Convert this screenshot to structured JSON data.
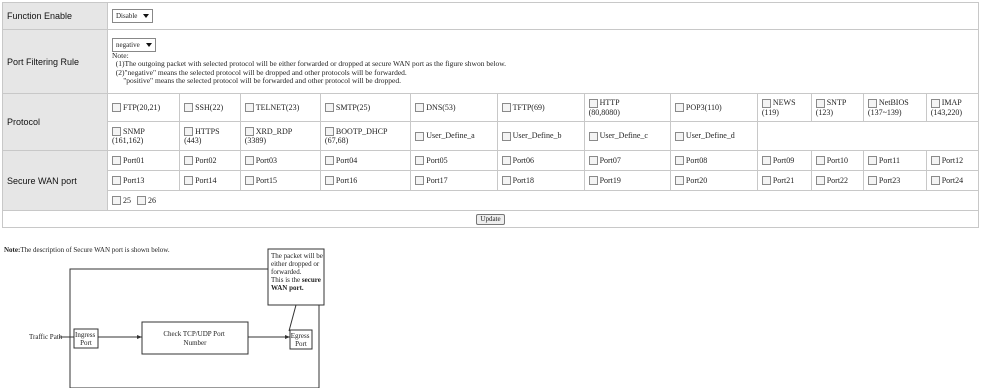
{
  "function_enable": {
    "label": "Function Enable",
    "value": "Disable"
  },
  "port_filtering": {
    "label": "Port Filtering Rule",
    "value": "negative",
    "note_title": "Note:",
    "note_lines": [
      "(1)The outgoing packet with selected protocol will be either forwarded or dropped at secure WAN port as the figure shwon below.",
      "(2)\"negative\" means the selected protocol will be dropped and other protocols will be forwarded.",
      "\"positive\" means the selected protocol will be forwarded and other protocol will be dropped."
    ]
  },
  "protocol": {
    "label": "Protocol",
    "row1": [
      {
        "l1": "FTP(20,21)",
        "l2": ""
      },
      {
        "l1": "SSH(22)",
        "l2": ""
      },
      {
        "l1": "TELNET(23)",
        "l2": ""
      },
      {
        "l1": "SMTP(25)",
        "l2": ""
      },
      {
        "l1": "DNS(53)",
        "l2": ""
      },
      {
        "l1": "TFTP(69)",
        "l2": ""
      },
      {
        "l1": "HTTP",
        "l2": "(80,8080)"
      },
      {
        "l1": "POP3(110)",
        "l2": ""
      },
      {
        "l1": "NEWS",
        "l2": "(119)"
      },
      {
        "l1": "SNTP",
        "l2": "(123)"
      },
      {
        "l1": "NetBIOS",
        "l2": "(137~139)"
      },
      {
        "l1": "IMAP",
        "l2": "(143,220)"
      }
    ],
    "row2": [
      {
        "l1": "SNMP",
        "l2": "(161,162)"
      },
      {
        "l1": "HTTPS",
        "l2": "(443)"
      },
      {
        "l1": "XRD_RDP",
        "l2": "(3389)"
      },
      {
        "l1": "BOOTP_DHCP",
        "l2": "(67,68)"
      },
      {
        "l1": "User_Define_a",
        "l2": ""
      },
      {
        "l1": "User_Define_b",
        "l2": ""
      },
      {
        "l1": "User_Define_c",
        "l2": ""
      },
      {
        "l1": "User_Define_d",
        "l2": ""
      }
    ]
  },
  "secure_wan": {
    "label": "Secure WAN port",
    "row1": [
      "Port01",
      "Port02",
      "Port03",
      "Port04",
      "Port05",
      "Port06",
      "Port07",
      "Port08",
      "Port09",
      "Port10",
      "Port11",
      "Port12"
    ],
    "row2": [
      "Port13",
      "Port14",
      "Port15",
      "Port16",
      "Port17",
      "Port18",
      "Port19",
      "Port20",
      "Port21",
      "Port22",
      "Port23",
      "Port24"
    ],
    "row3": [
      "25",
      "26"
    ]
  },
  "update_label": "Update",
  "bottom_note": {
    "bold": "Note:",
    "text": "The description of Secure WAN port is shown below."
  },
  "diagram": {
    "traffic_path": "Traffic Path",
    "ingress": [
      "Ingress",
      "Port"
    ],
    "check": [
      "Check TCP/UDP Port",
      "Number"
    ],
    "egress": [
      "Egress",
      "Port"
    ],
    "callout": [
      "The packet will be",
      "either dropped or",
      "forwarded.",
      "This is the "
    ],
    "callout_bold_1": "secure",
    "callout_bold_2": "WAN port."
  }
}
